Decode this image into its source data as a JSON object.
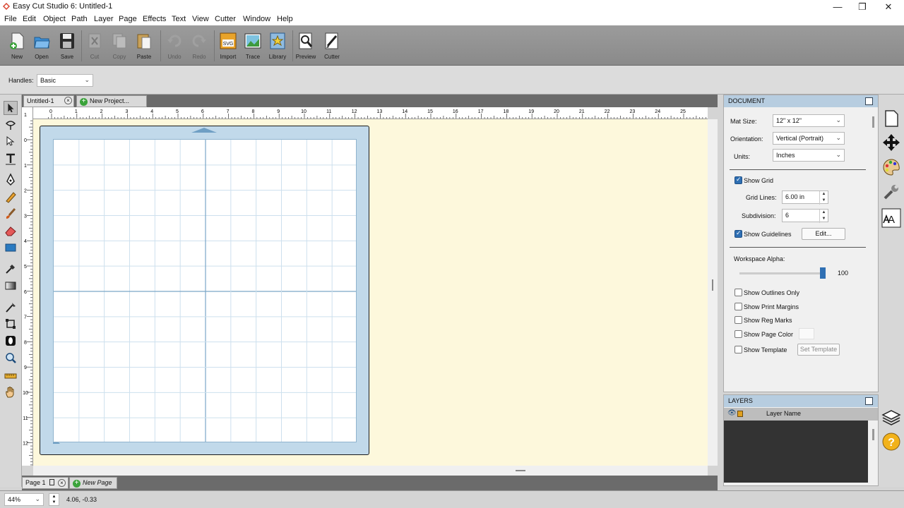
{
  "window": {
    "title": "Easy Cut Studio 6: Untitled-1",
    "minimize_glyph": "—",
    "restore_glyph": "❐",
    "close_glyph": "✕"
  },
  "menu": [
    "File",
    "Edit",
    "Object",
    "Path",
    "Layer",
    "Page",
    "Effects",
    "Text",
    "View",
    "Cutter",
    "Window",
    "Help"
  ],
  "toolbar": {
    "new": "New",
    "open": "Open",
    "save": "Save",
    "cut": "Cut",
    "copy": "Copy",
    "paste": "Paste",
    "undo": "Undo",
    "redo": "Redo",
    "import": "Import",
    "import_badge": "SVG",
    "trace": "Trace",
    "library": "Library",
    "preview": "Preview",
    "cutter": "Cutter"
  },
  "options": {
    "handles_label": "Handles:",
    "handles_value": "Basic"
  },
  "tabs": {
    "doc_tab": "Untitled-1",
    "new_project": "New Project..."
  },
  "ruler_top": [
    "0",
    "1",
    "2",
    "3",
    "4",
    "5",
    "6",
    "7",
    "8",
    "9",
    "10",
    "11",
    "12",
    "13",
    "14",
    "15",
    "16",
    "17",
    "18",
    "19",
    "20",
    "21",
    "22",
    "23",
    "24",
    "25"
  ],
  "ruler_left": [
    "1",
    "0",
    "1",
    "2",
    "3",
    "4",
    "5",
    "6",
    "7",
    "8",
    "9",
    "10",
    "11",
    "12"
  ],
  "pages": {
    "page_tab": "Page 1",
    "new_page": "New Page"
  },
  "status": {
    "zoom": "44%",
    "coords": "4.06, -0.33"
  },
  "document_panel": {
    "header": "DOCUMENT",
    "mat_size_label": "Mat Size:",
    "mat_size_value": "12\" x 12\"",
    "orientation_label": "Orientation:",
    "orientation_value": "Vertical (Portrait)",
    "units_label": "Units:",
    "units_value": "Inches",
    "show_grid": "Show Grid",
    "grid_lines_label": "Grid Lines:",
    "grid_lines_value": "6.00 in",
    "subdivision_label": "Subdivision:",
    "subdivision_value": "6",
    "show_guidelines": "Show Guidelines",
    "edit_button": "Edit...",
    "workspace_alpha_label": "Workspace Alpha:",
    "workspace_alpha_value": "100",
    "workspace_alpha": 100,
    "show_outlines_only": "Show Outlines Only",
    "show_print_margins": "Show Print Margins",
    "show_reg_marks": "Show Reg Marks",
    "show_page_color": "Show Page Color",
    "show_template": "Show Template",
    "set_template": "Set Template"
  },
  "layers_panel": {
    "header": "LAYERS",
    "column_name": "Layer Name"
  },
  "colors": {
    "accent": "#2f6fb3",
    "panel_header": "#b7cde0",
    "mat": "#c1d9ea",
    "workspace": "#fdf8dc"
  }
}
